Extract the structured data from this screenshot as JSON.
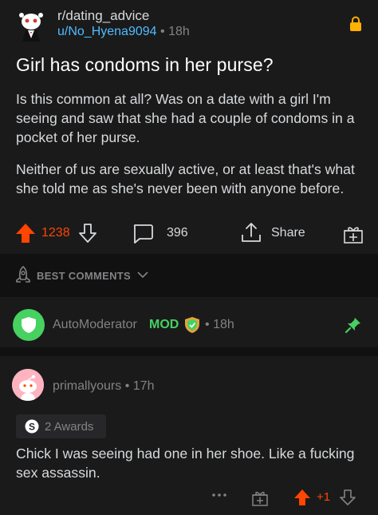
{
  "post": {
    "subreddit": "r/dating_advice",
    "author": "u/No_Hyena9094",
    "separator": "•",
    "age": "18h",
    "title": "Girl has condoms in her purse?",
    "body": [
      "Is this common at all? Was on a date with a girl I'm seeing and saw that she had a couple of condoms in a pocket of her purse.",
      "Neither of us are sexually active, or at least that's what she told me as she's never been with anyone before."
    ],
    "votes": "1238",
    "comments": "396",
    "share_label": "Share"
  },
  "sort": {
    "label": "BEST COMMENTS"
  },
  "mod_comment": {
    "author": "AutoModerator",
    "badge": "MOD",
    "separator": "•",
    "age": "18h"
  },
  "comment": {
    "author": "primallyours",
    "separator": "•",
    "age": "17h",
    "awards": "2 Awards",
    "body": "Chick I was seeing had one in her shoe. Like a fucking sex assassin.",
    "votes": "+1"
  },
  "colors": {
    "background": "#1a1a1b",
    "upvote": "#ff4500",
    "username_link": "#4fbcff",
    "mod_green": "#46d160",
    "lock": "#ffb000"
  }
}
